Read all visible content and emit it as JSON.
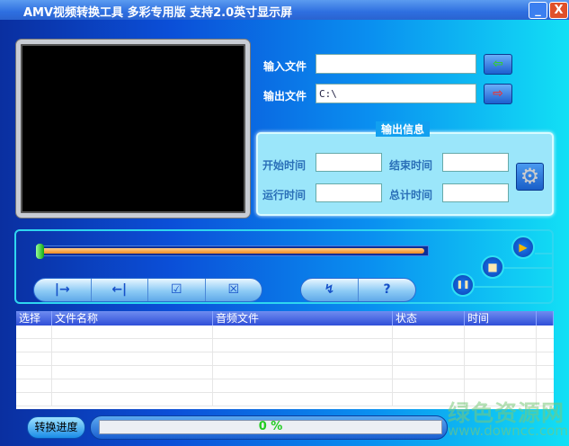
{
  "window": {
    "title": "AMV视频转换工具 多彩专用版 支持2.0英寸显示屏",
    "minimize": "_",
    "close": "X"
  },
  "files": {
    "input_label": "输入文件",
    "input_value": "",
    "output_label": "输出文件",
    "output_value": "C:\\"
  },
  "output_info": {
    "title": "输出信息",
    "start_label": "开始时间",
    "end_label": "结束时间",
    "run_label": "运行时间",
    "total_label": "总计时间",
    "start": "",
    "end": "",
    "run": "",
    "total": ""
  },
  "slider": {
    "position": 0
  },
  "edit_buttons": [
    "|→",
    "←|",
    "☑",
    "☒"
  ],
  "tool_buttons": [
    "↯",
    "?"
  ],
  "playback": {
    "play": "▶",
    "stop": "■",
    "pause": "❚❚"
  },
  "table": {
    "columns": [
      "选择",
      "文件名称",
      "音频文件",
      "状态",
      "时间"
    ],
    "rows": []
  },
  "progress": {
    "label": "转换进度",
    "value_text": "0 %",
    "value": 0
  },
  "watermark": {
    "name": "绿色资源网",
    "url": "www.downcc.com"
  },
  "colors": {
    "accent": "#2fd6f0",
    "progress_text": "#22cc22"
  }
}
